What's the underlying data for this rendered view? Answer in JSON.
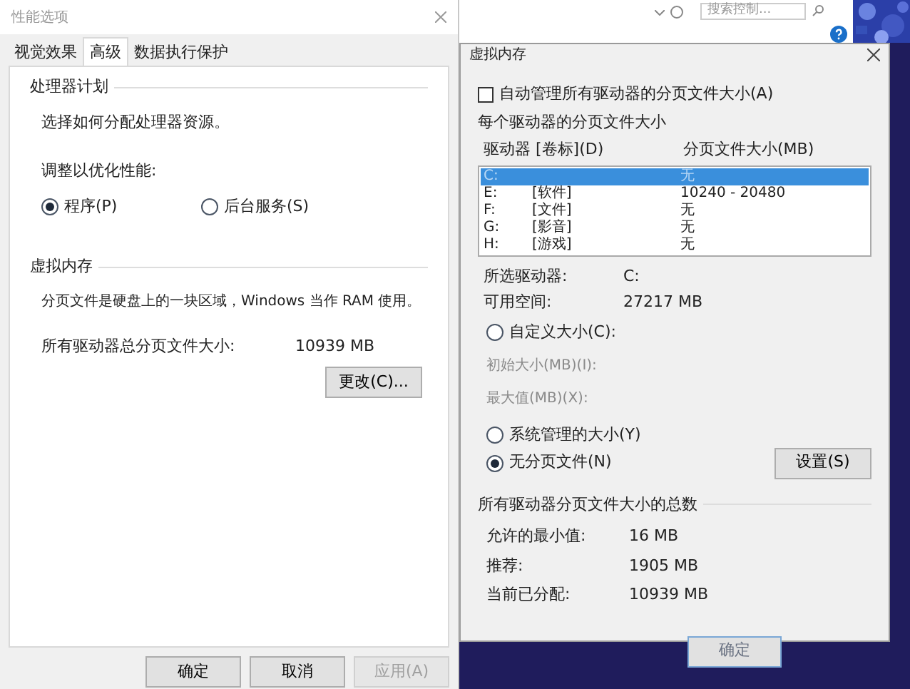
{
  "performance_dialog": {
    "title": "性能选项",
    "tabs": [
      {
        "label": "视觉效果",
        "selected": false
      },
      {
        "label": "高级",
        "selected": true
      },
      {
        "label": "数据执行保护",
        "selected": false
      }
    ],
    "processor_section": {
      "heading": "处理器计划",
      "description": "选择如何分配处理器资源。",
      "adjust_label": "调整以优化性能:",
      "options": [
        {
          "label": "程序(P)",
          "selected": true
        },
        {
          "label": "后台服务(S)",
          "selected": false
        }
      ]
    },
    "memory_section": {
      "heading": "虚拟内存",
      "description": "分页文件是硬盘上的一块区域，Windows 当作 RAM 使用。",
      "total_label": "所有驱动器总分页文件大小:",
      "total_value": "10939 MB",
      "change_button": "更改(C)..."
    },
    "buttons": [
      {
        "label": "确定",
        "disabled": false
      },
      {
        "label": "取消",
        "disabled": false
      },
      {
        "label": "应用(A)",
        "disabled": true
      }
    ]
  },
  "explorer": {
    "search_placeholder": "搜索控制..."
  },
  "virtual_memory_dialog": {
    "title": "虚拟内存",
    "auto_manage": {
      "label": "自动管理所有驱动器的分页文件大小(A)",
      "checked": false
    },
    "group_label": "每个驱动器的分页文件大小",
    "columns": [
      "驱动器 [卷标](D)",
      "分页文件大小(MB)"
    ],
    "drives": [
      {
        "drive": "C:",
        "size": "无",
        "selected": true
      },
      {
        "drive": "E:",
        "label": "[软件]",
        "size": "10240 - 20480",
        "selected": false
      },
      {
        "drive": "F:",
        "label": "[文件]",
        "size": "无",
        "selected": false
      },
      {
        "drive": "G:",
        "label": "[影音]",
        "size": "无",
        "selected": false
      },
      {
        "drive": "H:",
        "label": "[游戏]",
        "size": "无",
        "selected": false
      }
    ],
    "info": [
      {
        "label": "所选驱动器:",
        "value": "C:"
      },
      {
        "label": "可用空间:",
        "value": "27217 MB"
      }
    ],
    "custom": {
      "label": "自定义大小(C):",
      "selected": false
    },
    "custom_fields": [
      {
        "label": "初始大小(MB)(I):",
        "disabled": true
      },
      {
        "label": "最大值(MB)(X):",
        "disabled": true
      }
    ],
    "system_managed": {
      "label": "系统管理的大小(Y)",
      "selected": false
    },
    "no_paging": {
      "label": "无分页文件(N)",
      "selected": true
    },
    "set_button": "设置(S)",
    "totals_heading": "所有驱动器分页文件大小的总数",
    "totals": [
      {
        "label": "允许的最小值:",
        "value": "16 MB"
      },
      {
        "label": "推荐:",
        "value": "1905 MB"
      },
      {
        "label": "当前已分配:",
        "value": "10939 MB"
      }
    ],
    "ok_button": "确定"
  }
}
